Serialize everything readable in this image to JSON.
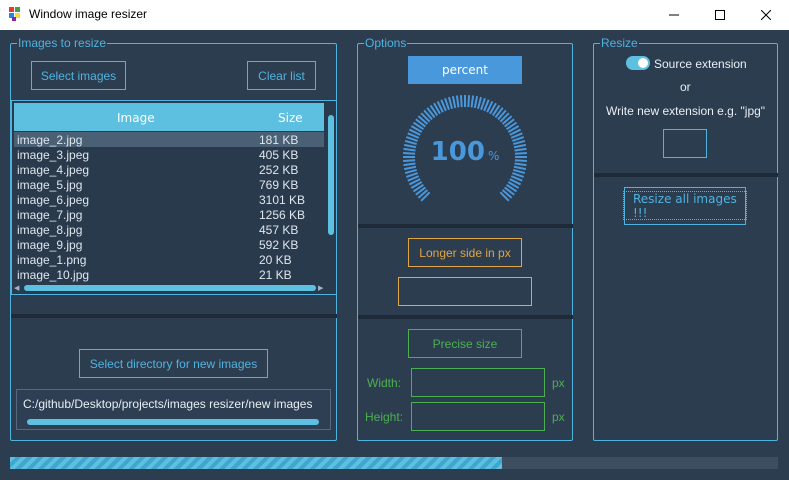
{
  "window": {
    "title": "Window image resizer"
  },
  "images_group": {
    "title": "Images to resize",
    "select_button": "Select images",
    "clear_button": "Clear list",
    "columns": [
      "Image",
      "Size"
    ],
    "rows": [
      {
        "name": "image_2.jpg",
        "size": "181 KB"
      },
      {
        "name": "image_3.jpeg",
        "size": "405 KB"
      },
      {
        "name": "image_4.jpeg",
        "size": "252 KB"
      },
      {
        "name": "image_5.jpg",
        "size": "769 KB"
      },
      {
        "name": "image_6.jpeg",
        "size": "3101 KB"
      },
      {
        "name": "image_7.jpg",
        "size": "1256 KB"
      },
      {
        "name": "image_8.jpg",
        "size": "457 KB"
      },
      {
        "name": "image_9.jpg",
        "size": "592 KB"
      },
      {
        "name": "image_1.png",
        "size": "20 KB"
      },
      {
        "name": "image_10.jpg",
        "size": "21 KB"
      }
    ],
    "select_dir_button": "Select directory for new images",
    "output_path": "C:/github/Desktop/projects/images resizer/new images"
  },
  "options_group": {
    "title": "Options",
    "mode_button": "percent",
    "dial_value": "100",
    "dial_unit": "%",
    "longer_side_button": "Longer side in px",
    "longer_side_value": "",
    "precise_button": "Precise size",
    "width_label": "Width:",
    "height_label": "Height:",
    "unit_px": "px",
    "width_value": "",
    "height_value": ""
  },
  "resize_group": {
    "title": "Resize",
    "toggle_label": "Source extension",
    "toggle_on": true,
    "or_text": "or",
    "hint": "Write new extension e.g. \"jpg\"",
    "extension_value": "",
    "resize_button": "Resize all images !!!"
  },
  "progress": {
    "fraction": 0.64
  },
  "colors": {
    "accent": "#4fb3df",
    "background": "#2d3d50",
    "orange": "#e0a544",
    "green": "#4caf50",
    "dial": "#4a98dc"
  }
}
